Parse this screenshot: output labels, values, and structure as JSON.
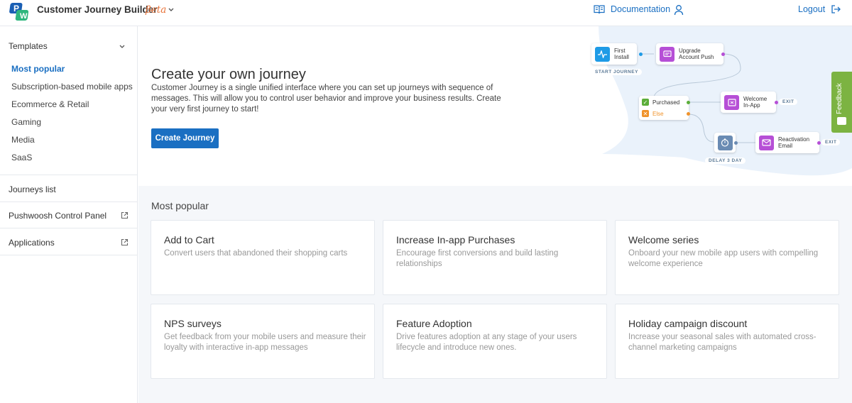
{
  "header": {
    "app_title": "Customer Journey Builder",
    "beta_label": "βeta",
    "documentation_label": "Documentation",
    "logout_label": "Logout"
  },
  "sidebar": {
    "templates_label": "Templates",
    "template_items": [
      {
        "label": "Most popular",
        "active": true
      },
      {
        "label": "Subscription-based mobile apps",
        "active": false
      },
      {
        "label": "Ecommerce & Retail",
        "active": false
      },
      {
        "label": "Gaming",
        "active": false
      },
      {
        "label": "Media",
        "active": false
      },
      {
        "label": "SaaS",
        "active": false
      }
    ],
    "journeys_list_label": "Journeys list",
    "control_panel_label": "Pushwoosh Control Panel",
    "applications_label": "Applications"
  },
  "hero": {
    "title": "Create your own journey",
    "description": "Customer Journey is a single unified interface where you can set up journeys with sequence of messages. This will allow you to control user behavior and improve your business results. Create your very first journey to start!",
    "create_button_label": "Create Journey"
  },
  "diagram": {
    "first_install": "First\nInstall",
    "start_journey": "START JOURNEY",
    "upgrade_push": "Upgrade\nAccount Push",
    "purchased": "Purchased",
    "else": "Else",
    "welcome_inapp": "Welcome\nIn-App",
    "exit_1": "EXIT",
    "delay": "DELAY 3 DAY",
    "reactivation_email": "Reactivation\nEmail",
    "exit_2": "EXIT"
  },
  "feedback_label": "Feedback",
  "popular": {
    "section_title": "Most popular",
    "cards": [
      {
        "title": "Add to Cart",
        "description": "Convert users that abandoned their shopping carts"
      },
      {
        "title": "Increase In-app Purchases",
        "description": "Encourage first conversions and build lasting relationships"
      },
      {
        "title": "Welcome series",
        "description": "Onboard your new mobile app users with compelling welcome experience"
      },
      {
        "title": "NPS surveys",
        "description": "Get feedback from your mobile users and measure their loyalty with interactive in-app messages"
      },
      {
        "title": "Feature Adoption",
        "description": "Drive features adoption at any stage of your users lifecycle and introduce new ones."
      },
      {
        "title": "Holiday campaign discount",
        "description": "Increase your seasonal sales with automated cross-channel marketing campaigns"
      }
    ]
  },
  "colors": {
    "accent": "#1a6fc2",
    "beta": "#e8743b",
    "feedback": "#7cb342",
    "purple": "#b64fd6",
    "delay": "#6a8bb3"
  }
}
